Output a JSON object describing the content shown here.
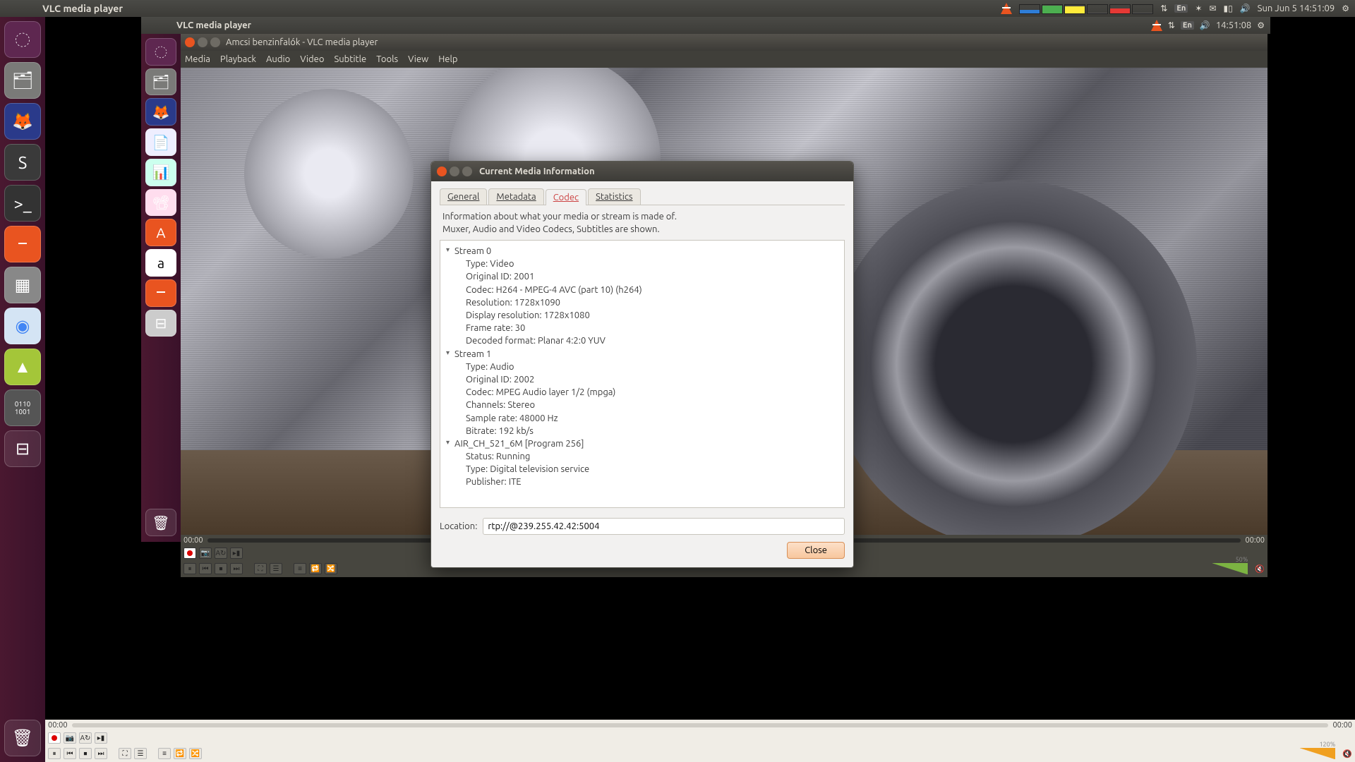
{
  "outer_topbar": {
    "title": "VLC media player",
    "lang": "En",
    "clock": "Sun Jun  5 14:51:09"
  },
  "inner_topbar": {
    "title": "VLC media player",
    "lang": "En",
    "clock": "14:51:08"
  },
  "vlc_window": {
    "title": "Amcsi benzinfalók - VLC media player",
    "menu": [
      "Media",
      "Playback",
      "Audio",
      "Video",
      "Subtitle",
      "Tools",
      "View",
      "Help"
    ],
    "time_current": "00:00",
    "time_total": "00:00",
    "volume_pct_inner": "50%",
    "volume_pct_outer": "120%"
  },
  "outer_vlc": {
    "time_current": "00:00",
    "time_total": "00:00"
  },
  "dialog": {
    "title": "Current Media Information",
    "tabs": {
      "general": "General",
      "metadata": "Metadata",
      "codec": "Codec",
      "statistics": "Statistics"
    },
    "info_line1": "Information about what your media or stream is made of.",
    "info_line2": "Muxer, Audio and Video Codecs, Subtitles are shown.",
    "stream0": {
      "header": "Stream 0",
      "type": "Type: Video",
      "orig": "Original ID: 2001",
      "codec": "Codec: H264 - MPEG-4 AVC (part 10) (h264)",
      "res": "Resolution: 1728x1090",
      "dres": "Display resolution: 1728x1080",
      "fr": "Frame rate: 30",
      "dec": "Decoded format: Planar 4:2:0 YUV"
    },
    "stream1": {
      "header": "Stream 1",
      "type": "Type: Audio",
      "orig": "Original ID: 2002",
      "codec": "Codec: MPEG Audio layer 1/2 (mpga)",
      "chan": "Channels: Stereo",
      "sr": "Sample rate: 48000 Hz",
      "br": "Bitrate: 192 kb/s"
    },
    "program": {
      "header": "AIR_CH_521_6M [Program 256]",
      "status": "Status: Running",
      "type": "Type: Digital television service",
      "pub": "Publisher: ITE"
    },
    "location_label": "Location:",
    "location_value": "rtp://@239.255.42.42:5004",
    "close": "Close"
  }
}
